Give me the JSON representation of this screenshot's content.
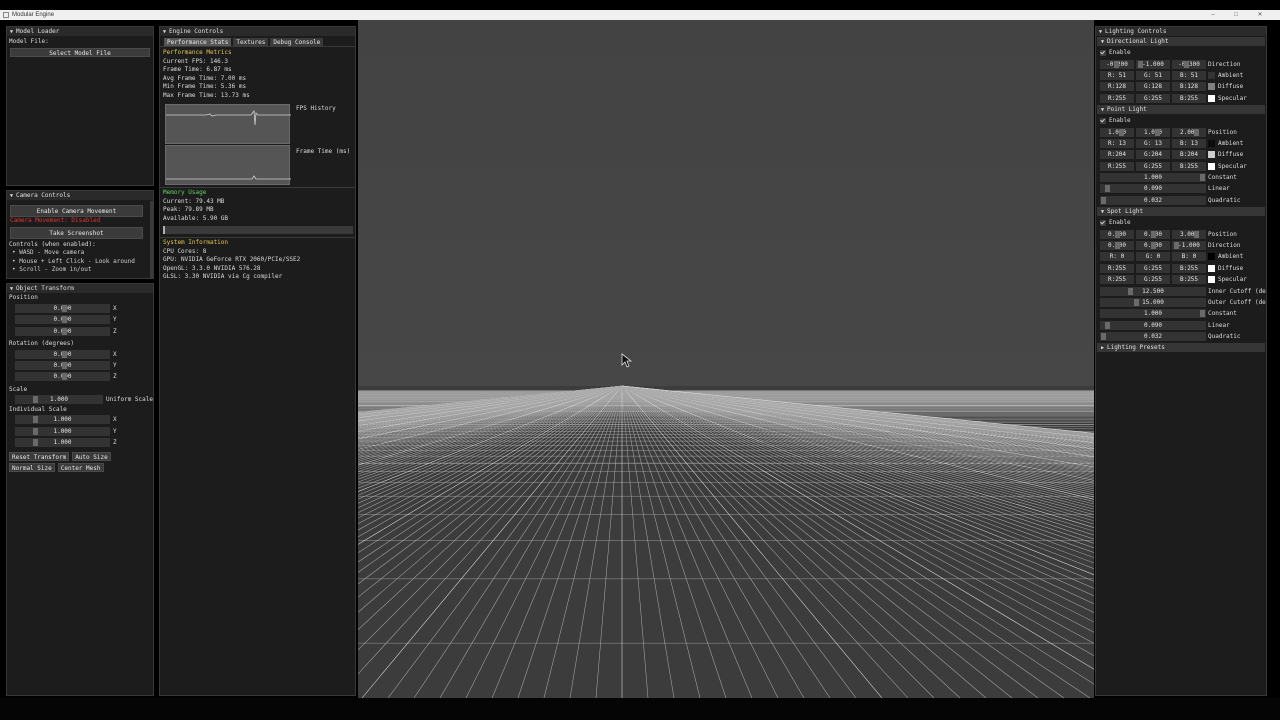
{
  "window": {
    "title": "Modular Engine",
    "min": "–",
    "max": "□",
    "close": "✕"
  },
  "model_loader": {
    "title": "Model Loader",
    "file_label": "Model File:",
    "select_button": "Select Model File"
  },
  "camera_controls": {
    "title": "Camera Controls",
    "enable_button": "Enable Camera Movement",
    "status": "Camera Movement: Disabled",
    "screenshot_button": "Take Screenshot",
    "controls_heading": "Controls (when enabled):",
    "controls": [
      "• WASD - Move camera",
      "• Mouse + Left Click - Look around",
      "• Scroll - Zoom in/out"
    ]
  },
  "object_transform": {
    "title": "Object Transform",
    "position_label": "Position",
    "position": [
      {
        "value": "0.000",
        "axis": "X"
      },
      {
        "value": "0.000",
        "axis": "Y"
      },
      {
        "value": "0.000",
        "axis": "Z"
      }
    ],
    "rotation_label": "Rotation (degrees)",
    "rotation": [
      {
        "value": "0.000",
        "axis": "X"
      },
      {
        "value": "0.000",
        "axis": "Y"
      },
      {
        "value": "0.000",
        "axis": "Z"
      }
    ],
    "scale_label": "Scale",
    "uniform_scale": {
      "value": "1.000",
      "label": "Uniform Scale"
    },
    "individual_label": "Individual Scale",
    "individual": [
      {
        "value": "1.000",
        "axis": "X"
      },
      {
        "value": "1.000",
        "axis": "Y"
      },
      {
        "value": "1.000",
        "axis": "Z"
      }
    ],
    "buttons_row1": [
      "Reset Transform",
      "Auto Size"
    ],
    "buttons_row2": [
      "Normal Size",
      "Center Mesh"
    ]
  },
  "engine_controls": {
    "title": "Engine Controls",
    "tabs": [
      "Performance Stats",
      "Textures",
      "Debug Console"
    ],
    "perf_heading": "Performance Metrics",
    "metrics": [
      "Current FPS: 146.3",
      "Frame Time: 6.87 ms",
      "Avg Frame Time: 7.00 ms",
      "Min Frame Time: 5.36 ms",
      "Max Frame Time: 13.73 ms"
    ],
    "fps_history_label": "FPS History",
    "frame_time_label": "Frame Time (ms)",
    "memory_heading": "Memory Usage",
    "memory": [
      "Current: 79.43 MB",
      "Peak: 79.89 MB",
      "Available: 5.90 GB"
    ],
    "memory_fraction": 0.013,
    "system_heading": "System Information",
    "system": [
      "CPU Cores: 8",
      "GPU: NVIDIA GeForce RTX 2060/PCIe/SSE2",
      "OpenGL: 3.3.0 NVIDIA 576.28",
      "GLSL: 3.30 NVIDIA via Cg compiler"
    ]
  },
  "lighting": {
    "title": "Lighting Controls",
    "enable_label": "Enable",
    "directional": {
      "title": "Directional Light",
      "direction": [
        "-0.200",
        "-1.000",
        "-0.300"
      ],
      "direction_label": "Direction",
      "ambient": [
        "R: 51",
        "G: 51",
        "B: 51"
      ],
      "ambient_label": "Ambient",
      "ambient_color": "#333333",
      "diffuse": [
        "R:128",
        "G:128",
        "B:128"
      ],
      "diffuse_label": "Diffuse",
      "diffuse_color": "#808080",
      "specular": [
        "R:255",
        "G:255",
        "B:255"
      ],
      "specular_label": "Specular",
      "specular_color": "#ffffff"
    },
    "point": {
      "title": "Point Light",
      "position": [
        "1.000",
        "1.000",
        "2.000"
      ],
      "position_label": "Position",
      "ambient": [
        "R: 13",
        "G: 13",
        "B: 13"
      ],
      "ambient_label": "Ambient",
      "ambient_color": "#0d0d0d",
      "diffuse": [
        "R:204",
        "G:204",
        "B:204"
      ],
      "diffuse_label": "Diffuse",
      "diffuse_color": "#cccccc",
      "specular": [
        "R:255",
        "G:255",
        "B:255"
      ],
      "specular_label": "Specular",
      "specular_color": "#ffffff",
      "constant": "1.000",
      "constant_label": "Constant",
      "linear": "0.090",
      "linear_label": "Linear",
      "quadratic": "0.032",
      "quadratic_label": "Quadratic"
    },
    "spot": {
      "title": "Spot Light",
      "position": [
        "0.000",
        "0.000",
        "3.000"
      ],
      "position_label": "Position",
      "direction": [
        "0.000",
        "0.000",
        "-1.000"
      ],
      "direction_label": "Direction",
      "ambient": [
        "R: 0",
        "G: 0",
        "B: 0"
      ],
      "ambient_label": "Ambient",
      "ambient_color": "#000000",
      "diffuse": [
        "R:255",
        "G:255",
        "B:255"
      ],
      "diffuse_label": "Diffuse",
      "diffuse_color": "#ffffff",
      "specular": [
        "R:255",
        "G:255",
        "B:255"
      ],
      "specular_label": "Specular",
      "specular_color": "#ffffff",
      "inner": "12.500",
      "inner_label": "Inner Cutoff (de",
      "outer": "15.000",
      "outer_label": "Outer Cutoff (de",
      "constant": "1.000",
      "constant_label": "Constant",
      "linear": "0.090",
      "linear_label": "Linear",
      "quadratic": "0.032",
      "quadratic_label": "Quadratic"
    },
    "presets_title": "Lighting Presets"
  }
}
